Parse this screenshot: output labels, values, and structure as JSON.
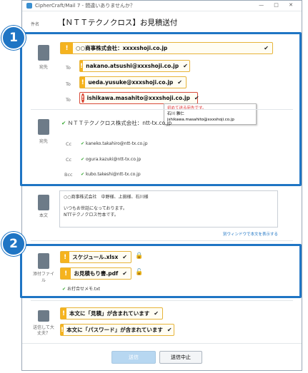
{
  "window": {
    "title": "CipherCraft/Mail 7 - 間違いありませんか？"
  },
  "subject": {
    "label": "件名",
    "value": "【ＮＴＴテクノクロス】お見積送付"
  },
  "recipients1": {
    "label": "宛先",
    "company": "○○商事株式会社：xxxxshoji.co.jp",
    "to_label": "To",
    "to": [
      "nakano.atsushi@xxxshoji.co.jp",
      "ueda.yusuke@xxxshoji.co.jp",
      "ishikawa.masahito@xxxshoji.co.jp"
    ],
    "tooltip": {
      "warn": "初めて送る宛先です。",
      "name": "石川 雅仁",
      "email": "ishikawa.masahito@xxxshoji.co.jp"
    }
  },
  "recipients2": {
    "label": "宛先",
    "company": "ＮＴＴテクノクロス株式会社：ntt-tx.co.jp",
    "cc_label": "Cc",
    "bcc_label": "Bcc",
    "cc": [
      "kaneko.takahiro@ntt-tx.co.jp",
      "ogura.kazuki@ntt-tx.co.jp"
    ],
    "bcc": "kubo.takeshi@ntt-tx.co.jp"
  },
  "body": {
    "label": "本文",
    "lines": [
      "○○商事株式会社　中野様、上田様、石川様",
      "",
      "いつもお世話になっております。",
      "NTTテクノクロス竹本です。"
    ],
    "link": "別ウィンドウで本文を表示する"
  },
  "attachments": {
    "label": "添付ファイル",
    "files": [
      "スケジュール.xlsx",
      "お見積もり書.pdf"
    ],
    "note": "お打合せメモ.txt"
  },
  "sendcheck": {
    "label": "送信して大丈夫？",
    "items": [
      "本文に「見積」が含まれています",
      "本文に「パスワード」が含まれています"
    ]
  },
  "buttons": {
    "send": "送信",
    "cancel": "送信中止"
  },
  "badges": {
    "one": "1",
    "two": "2"
  },
  "colors": {
    "accent": "#1f75c4",
    "warn": "#f5b31e",
    "danger": "#d83a2a",
    "ok": "#3aaa35"
  }
}
